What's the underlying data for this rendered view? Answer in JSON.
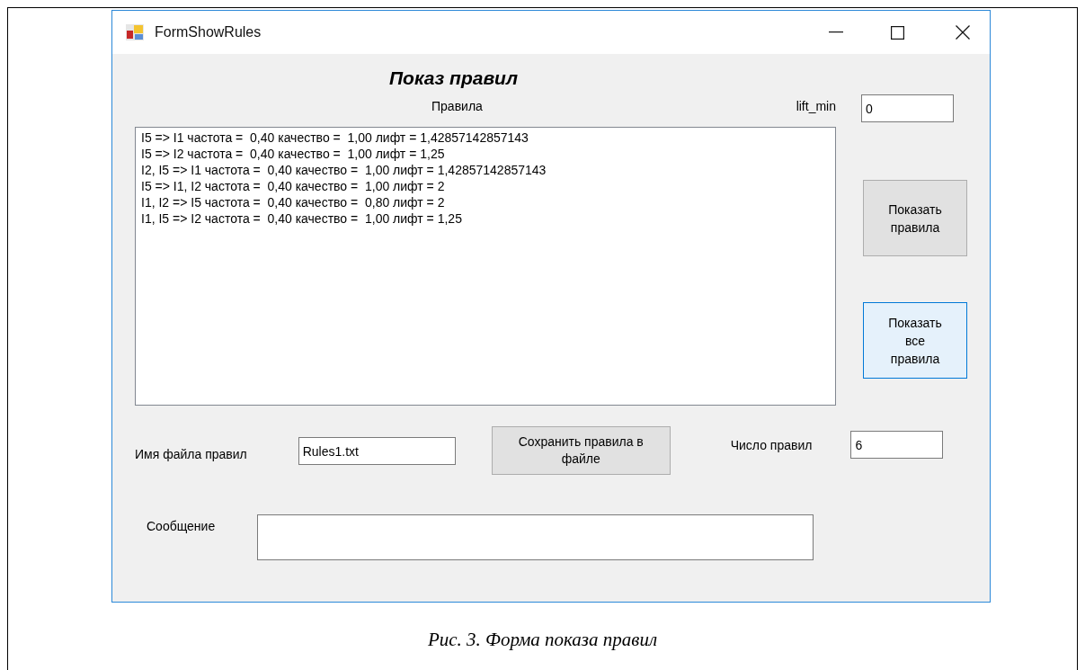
{
  "window": {
    "title": "FormShowRules"
  },
  "heading": "Показ правил",
  "rules_label": "Правила",
  "lift_min": {
    "label": "lift_min",
    "value": "0"
  },
  "rules": [
    "I5 => I1 частота =  0,40 качество =  1,00 лифт = 1,42857142857143",
    "I5 => I2 частота =  0,40 качество =  1,00 лифт = 1,25",
    "I2, I5 => I1 частота =  0,40 качество =  1,00 лифт = 1,42857142857143",
    "I5 => I1, I2 частота =  0,40 качество =  1,00 лифт = 2",
    "I1, I2 => I5 частота =  0,40 качество =  0,80 лифт = 2",
    "I1, I5 => I2 частота =  0,40 качество =  1,00 лифт = 1,25"
  ],
  "side_buttons": [
    {
      "label": "Показать\nправила",
      "focused": false
    },
    {
      "label": "Показать\nвсе\nправила",
      "focused": true
    }
  ],
  "file_name": {
    "label": "Имя файла правил",
    "value": "Rules1.txt"
  },
  "save_button": {
    "label": "Сохранить правила в\nфайле",
    "focused": false
  },
  "rule_count": {
    "label": "Число правил",
    "value": "6"
  },
  "message": {
    "label": "Сообщение"
  },
  "caption": "Рис. 3. Форма показа правил"
}
